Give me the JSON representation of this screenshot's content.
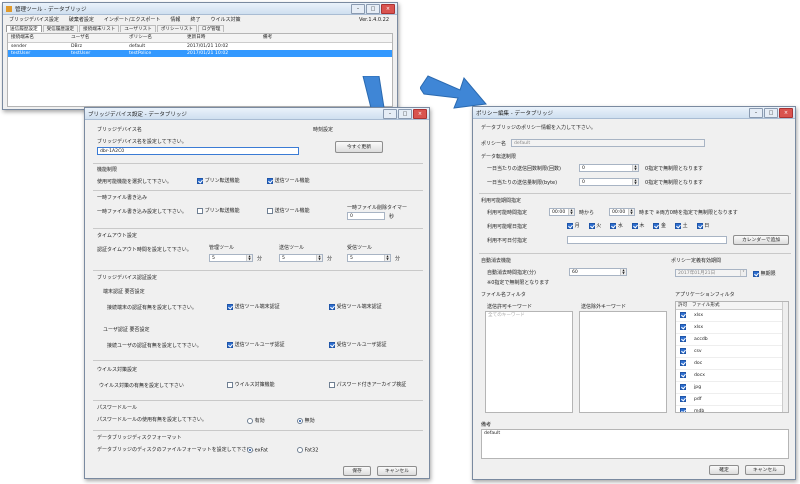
{
  "main": {
    "title": "管理ツール - データブリッジ",
    "menu": [
      "ブリッジデバイス設定",
      "破棄者設定",
      "インポート/エクスポート",
      "情報",
      "終了",
      "ウイルス対策"
    ],
    "version": "Ver.1.4.0.22",
    "tabs": [
      "送信履歴設定",
      "受信履歴設定",
      "接続端末リスト",
      "ユーザリスト",
      "ポリシーリスト",
      "ログ管理"
    ],
    "columns": [
      "接続端末名",
      "ユーザ名",
      "ポリシー名",
      "更新日時",
      "備考"
    ],
    "rows": [
      [
        "sender",
        "DBrz",
        "default",
        "2017/01/21 10:02",
        ""
      ],
      [
        "testUser",
        "testUser",
        "testPolice",
        "2017/01/21 10:02",
        ""
      ]
    ]
  },
  "bridge": {
    "title": "ブリッジデバイス設定 - データブリッジ",
    "name_title": "ブリッジデバイス名",
    "name_desc": "ブリッジデバイス名を設定して下さい。",
    "name_value": "dbr-1A2C0",
    "time_title": "時刻設定",
    "time_button": "今すぐ更新",
    "func_title": "機能制限",
    "func_desc": "使用可能機能を選択して下さい。",
    "func_cb1": "ブリン転送機能",
    "func_cb2": "送信ツール機能",
    "temp_title": "一時ファイル書き込み",
    "temp_desc": "一時ファイル書き込み設定して下さい。",
    "temp_cb1": "ブリン転送機能",
    "temp_cb2": "送信ツール機能",
    "temp_timer_label": "一時ファイル削除タイマー",
    "temp_timer_value": "0",
    "temp_timer_unit": "秒",
    "timeout_title": "タイムアウト設定",
    "timeout_desc": "認証タイムアウト時間を設定して下さい。",
    "timeout_labels": [
      "管理ツール",
      "送信ツール",
      "受信ツール"
    ],
    "timeout_values": [
      "5",
      "5",
      "5"
    ],
    "timeout_unit": "分",
    "auth_title": "ブリッジデバイス認証設定",
    "term_title": "端末認証 要否設定",
    "term_desc": "接続端末の認証有無を設定して下さい。",
    "term_cb1": "送信ツール端末認証",
    "term_cb2": "受信ツール端末認証",
    "user_title": "ユーザ認証 要否設定",
    "user_desc": "接続ユーザの認証有無を設定して下さい。",
    "user_cb1": "送信ツールユーザ認証",
    "user_cb2": "受信ツールユーザ認証",
    "virus_title": "ウイルス対策設定",
    "virus_desc": "ウイルス対策の有無を設定して下さい",
    "virus_cb1": "ウイルス対策機能",
    "virus_cb2": "パスワード付きアーカイブ検証",
    "pw_title": "パスワードルール",
    "pw_desc": "パスワードルールの使用有無を設定して下さい。",
    "pw_r1": "有効",
    "pw_r2": "無効",
    "fmt_title": "データブリッジディスクフォーマット",
    "fmt_desc": "データブリッジのディスクのファイルフォーマットを設定して下さい。",
    "fmt_r1": "exFat",
    "fmt_r2": "Fat32",
    "save": "保存",
    "cancel": "キャンセル"
  },
  "policy": {
    "title": "ポリシー編集 - データブリッジ",
    "desc": "データブリッジのポリシー情報を入力して下さい。",
    "name_label": "ポリシー名",
    "name_value": "default",
    "transfer_title": "データ転送制限",
    "limit1_label": "一日当たりの送信回数制限(回数)",
    "limit1_value": "0",
    "limit1_note": "0指定で無制限となります",
    "limit2_label": "一日当たりの送信量制限(byte)",
    "limit2_value": "0",
    "limit2_note": "0指定で無制限となります",
    "period_title": "利用可能期間指定",
    "time_label": "利用可能時間指定",
    "time_from": "00:00",
    "time_mid": "時から",
    "time_to": "00:00",
    "time_note": "時まで ※両方0時を指定で無制限となります",
    "day_label": "利用可能曜日指定",
    "days": [
      "月",
      "火",
      "水",
      "木",
      "金",
      "土",
      "日"
    ],
    "date_label": "利用不可日付指定",
    "calendar_button": "カレンダーで追加",
    "auto_title": "自動消去機能",
    "auto_label": "自動消去時間指定(分)",
    "auto_value": "60",
    "auto_note": "※0指定で無制限となります",
    "expire_title": "ポリシー定義有効期間",
    "expire_value": "2017年01月21日",
    "expire_cb": "無期限",
    "filter_title": "ファイル名フィルタ",
    "allow_label": "送信許可キーワード",
    "allow_placeholder": "全てのキーワード",
    "deny_label": "送信除外キーワード",
    "app_title": "アプリケーションフィルタ",
    "app_cols": [
      "許可",
      "ファイル形式"
    ],
    "app_rows": [
      "xlsx",
      "xlsx",
      "accdb",
      "csv",
      "doc",
      "docx",
      "jpg",
      "pdf",
      "mdb"
    ],
    "remarks_label": "備考",
    "remarks_value": "default",
    "ok": "確定",
    "cancel": "キャンセル"
  },
  "colors": {
    "selection": "#3399ff",
    "arrow": "#3f86d6"
  }
}
